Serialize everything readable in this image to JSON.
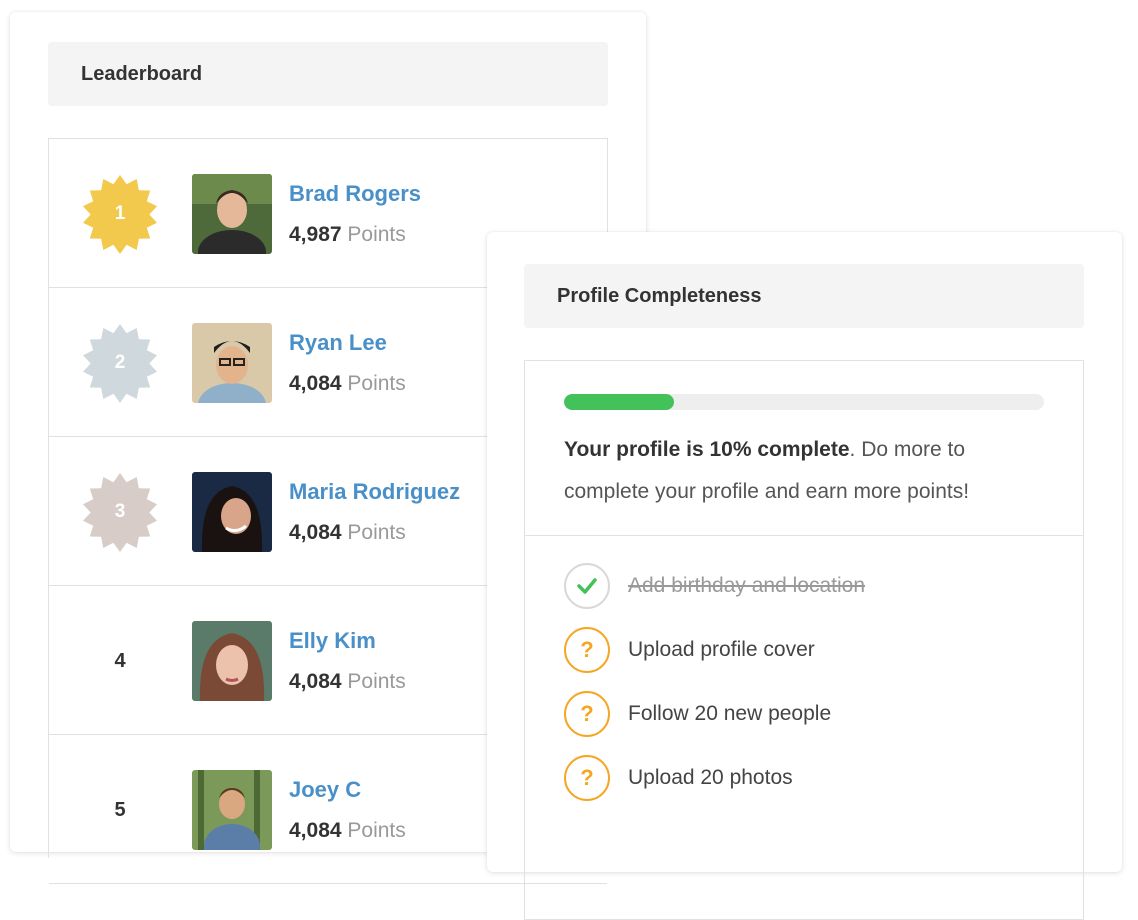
{
  "leaderboard": {
    "title": "Leaderboard",
    "points_label": "Points",
    "entries": [
      {
        "rank": "1",
        "name": "Brad Rogers",
        "points": "4,987",
        "badge_color": "#f2c94c"
      },
      {
        "rank": "2",
        "name": "Ryan Lee",
        "points": "4,084",
        "badge_color": "#cfd8dc"
      },
      {
        "rank": "3",
        "name": "Maria Rodriguez",
        "points": "4,084",
        "badge_color": "#d7ccc8"
      },
      {
        "rank": "4",
        "name": "Elly Kim",
        "points": "4,084"
      },
      {
        "rank": "5",
        "name": "Joey C",
        "points": "4,084"
      }
    ]
  },
  "profile": {
    "title": "Profile Completeness",
    "progress_fraction": 0.23,
    "progress_color": "#43c25a",
    "summary_bold": "Your profile is 10% complete",
    "summary_rest": ". Do more to complete your profile and earn more points!",
    "tasks": [
      {
        "label": "Add birthday and location",
        "done": true
      },
      {
        "label": "Upload profile cover",
        "done": false
      },
      {
        "label": "Follow 20 new people",
        "done": false
      },
      {
        "label": "Upload 20 photos",
        "done": false
      }
    ]
  }
}
